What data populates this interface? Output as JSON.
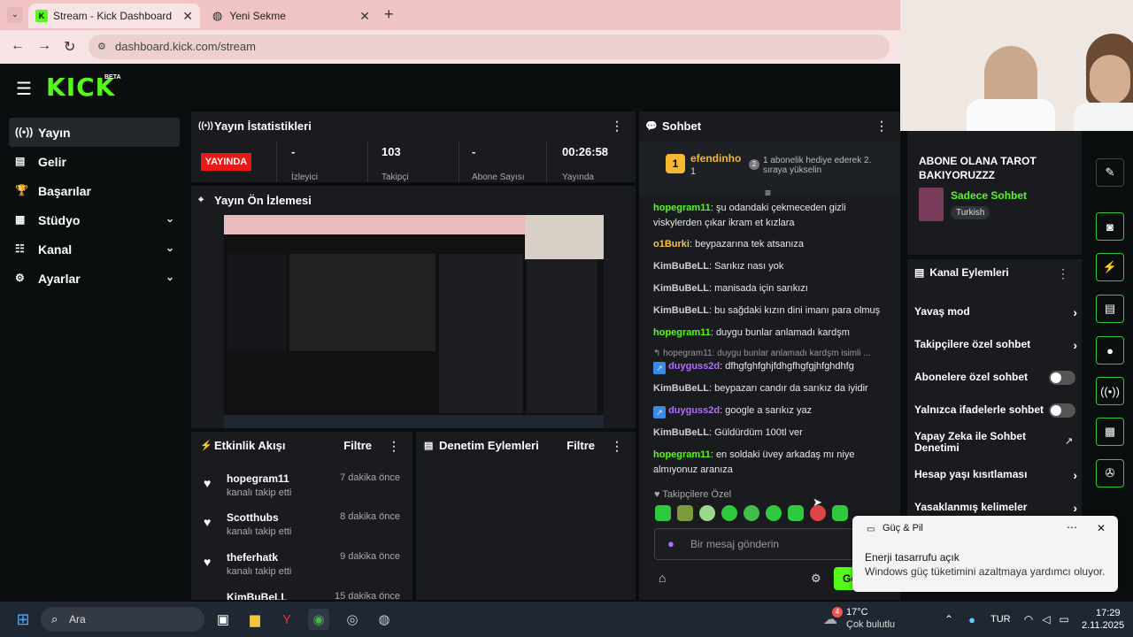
{
  "browser": {
    "tabs": [
      {
        "label": "Stream - Kick Dashboard"
      },
      {
        "label": "Yeni Sekme"
      }
    ],
    "url": "dashboard.kick.com/stream"
  },
  "brand": {
    "logo": "KICK",
    "beta": "BETA"
  },
  "sidebar": {
    "items": [
      {
        "label": "Yayın",
        "icon": "broadcast-icon"
      },
      {
        "label": "Gelir",
        "icon": "chart-icon"
      },
      {
        "label": "Başarılar",
        "icon": "trophy-icon"
      },
      {
        "label": "Stüdyo",
        "icon": "layout-icon"
      },
      {
        "label": "Kanal",
        "icon": "sliders-icon"
      },
      {
        "label": "Ayarlar",
        "icon": "gear-icon"
      }
    ]
  },
  "stats": {
    "title": "Yayın İstatistikleri",
    "live_badge": "YAYINDA",
    "values": [
      {
        "value": "-",
        "label": "İzleyici"
      },
      {
        "value": "103",
        "label": "Takipçi"
      },
      {
        "value": "-",
        "label": "Abone Sayısı"
      },
      {
        "value": "00:26:58",
        "label": "Yayında"
      }
    ]
  },
  "preview": {
    "title": "Yayın Ön İzlemesi"
  },
  "activity": {
    "title": "Etkinlik Akışı",
    "filter": "Filtre",
    "items": [
      {
        "name": "hopegram11",
        "sub": "kanalı takip etti",
        "time": "7 dakika önce"
      },
      {
        "name": "Scotthubs",
        "sub": "kanalı takip etti",
        "time": "8 dakika önce"
      },
      {
        "name": "theferhatk",
        "sub": "kanalı takip etti",
        "time": "9 dakika önce"
      },
      {
        "name": "KimBuBeLL",
        "sub": "",
        "time": "15 dakika önce"
      }
    ]
  },
  "moderation": {
    "title": "Denetim Eylemleri",
    "filter": "Filtre"
  },
  "chat": {
    "title": "Sohbet",
    "pinned_user": "efendinho",
    "pinned_count": "1",
    "pinned_rank": "2",
    "pinned_text": "1 abonelik hediye ederek 2. sıraya yükselin",
    "messages": [
      {
        "user": "hopegram11",
        "color": "#53fc18",
        "text": "şu odandaki çekmeceden gizli viskylerden çıkar ikram et kızlara"
      },
      {
        "user": "o1Burki",
        "color": "#f5c542",
        "text": "beypazarına tek atsanıza"
      },
      {
        "user": "KimBuBeLL",
        "color": "#cfcfcf",
        "text": "Sarıkız nası yok"
      },
      {
        "user": "KimBuBeLL",
        "color": "#cfcfcf",
        "text": "manisada için sarıkızı"
      },
      {
        "user": "KimBuBeLL",
        "color": "#cfcfcf",
        "text": "bu sağdaki kızın dini imanı para olmuş"
      },
      {
        "user": "hopegram11",
        "color": "#53fc18",
        "text": "duygu bunlar anlamadı kardşm"
      },
      {
        "user": "duyguss2d",
        "color": "#b36cff",
        "text": "dfhgfghfghjfdhgfhgfgjhfghdhfg"
      },
      {
        "user": "KimBuBeLL",
        "color": "#cfcfcf",
        "text": "beypazarı candır da sarıkız da iyidir"
      },
      {
        "user": "duyguss2d",
        "color": "#b36cff",
        "text": "google a sarıkız yaz"
      },
      {
        "user": "KimBuBeLL",
        "color": "#cfcfcf",
        "text": "Güldürdüm 100tl ver"
      },
      {
        "user": "hopegram11",
        "color": "#53fc18",
        "text": "en soldaki üvey arkadaş mı niye almıyonuz aranıza"
      }
    ],
    "reply_preview": "hopegram11: duygu bunlar anlamadı kardşm isimli ...",
    "followers_only": "Takipçilere Özel",
    "input_placeholder": "Bir mesaj gönderin",
    "send_label": "Gö"
  },
  "stream_info": {
    "title": "ABONE OLANA TAROT BAKIYORUZZZ",
    "category": "Sadece Sohbet",
    "language": "Turkish"
  },
  "channel_actions": {
    "title": "Kanal Eylemleri",
    "items": [
      {
        "label": "Yavaş mod",
        "type": "arrow"
      },
      {
        "label": "Takipçilere özel sohbet",
        "type": "arrow"
      },
      {
        "label": "Abonelere özel sohbet",
        "type": "toggle"
      },
      {
        "label": "Yalnızca ifadelerle sohbet",
        "type": "toggle"
      },
      {
        "label": "Yapay Zeka ile Sohbet Denetimi",
        "type": "external"
      },
      {
        "label": "Hesap yaşı kısıtlaması",
        "type": "arrow"
      },
      {
        "label": "Yasaklanmış kelimeler",
        "type": "arrow"
      }
    ]
  },
  "toast": {
    "app": "Güç & Pil",
    "title": "Enerji tasarrufu açık",
    "body": "Windows güç tüketimini azaltmaya yardımcı oluyor."
  },
  "taskbar": {
    "search": "Ara",
    "weather_temp": "17°C",
    "weather_desc": "Çok bulutlu",
    "weather_badge": "4",
    "lang": "TUR",
    "time": "17:29",
    "date": "2.11.2025"
  },
  "colors": {
    "accent": "#53fc18",
    "panel": "#191b1f",
    "live": "#e91916"
  }
}
